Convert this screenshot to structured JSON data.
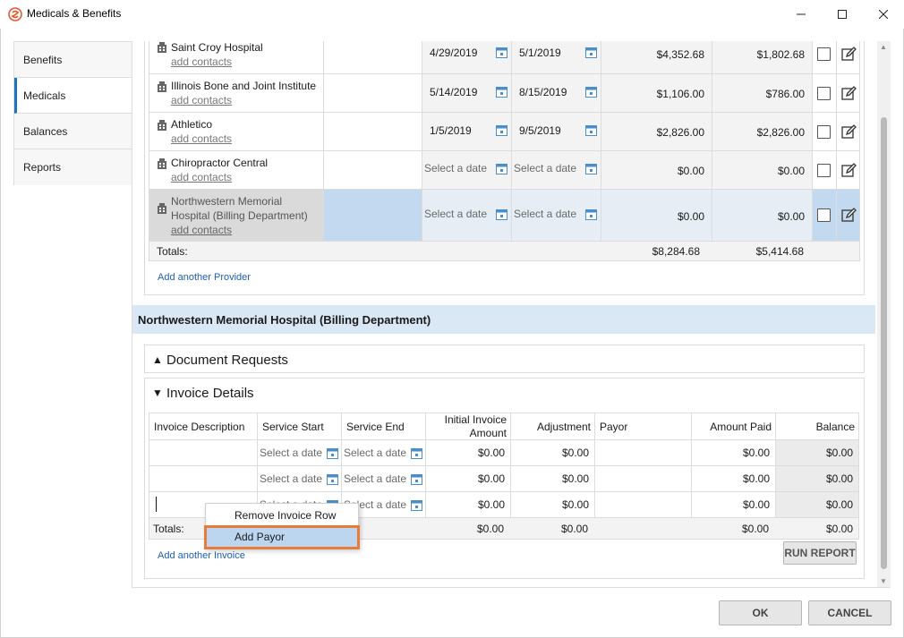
{
  "window": {
    "title": "Medicals & Benefits",
    "logo": "app-logo-icon",
    "controls": [
      "minimize-icon",
      "maximize-icon",
      "close-icon"
    ]
  },
  "nav": {
    "items": [
      {
        "label": "Benefits",
        "active": false
      },
      {
        "label": "Medicals",
        "active": true
      },
      {
        "label": "Balances",
        "active": false
      },
      {
        "label": "Reports",
        "active": false
      }
    ]
  },
  "providers": {
    "rows": [
      {
        "name": "Saint Croy Hospital",
        "contacts": "add contacts",
        "start": "4/29/2019",
        "end": "5/1/2019",
        "cost": "$4,352.68",
        "paid": "$1,802.68"
      },
      {
        "name": "Illinois Bone and Joint Institute",
        "contacts": "add contacts",
        "start": "5/14/2019",
        "end": "8/15/2019",
        "cost": "$1,106.00",
        "paid": "$786.00"
      },
      {
        "name": "Athletico",
        "contacts": "add contacts",
        "start": "1/5/2019",
        "end": "9/5/2019",
        "cost": "$2,826.00",
        "paid": "$2,826.00"
      },
      {
        "name": "Chiropractor Central",
        "contacts": "add contacts",
        "start": "Select a date",
        "end": "Select a date",
        "cost": "$0.00",
        "paid": "$0.00"
      },
      {
        "name_line1": "Northwestern Memorial",
        "name_line2": "Hospital (Billing Department)",
        "contacts": "add contacts",
        "start": "Select a date",
        "end": "Select a date",
        "cost": "$0.00",
        "paid": "$0.00",
        "selected": true
      }
    ],
    "totals_label": "Totals:",
    "total_cost": "$8,284.68",
    "total_paid": "$5,414.68",
    "add_link": "Add another Provider"
  },
  "selected_provider": {
    "title": "Northwestern Memorial Hospital (Billing Department)"
  },
  "document_requests": {
    "arrow": "▲",
    "title": "Document Requests"
  },
  "invoice_details": {
    "arrow": "▼",
    "title": "Invoice Details",
    "headers": {
      "desc": "Invoice Description",
      "start": "Service Start",
      "end": "Service End",
      "init_line1": "Initial Invoice",
      "init_line2": "Amount",
      "adj": "Adjustment",
      "payor": "Payor",
      "paid": "Amount Paid",
      "balance": "Balance"
    },
    "rows": [
      {
        "start": "Select a date",
        "end": "Select a date",
        "init": "$0.00",
        "adj": "$0.00",
        "paid": "$0.00",
        "balance": "$0.00"
      },
      {
        "start": "Select a date",
        "end": "Select a date",
        "init": "$0.00",
        "adj": "$0.00",
        "paid": "$0.00",
        "balance": "$0.00"
      },
      {
        "start": "Select a date",
        "end": "Select a date",
        "init": "$0.00",
        "adj": "$0.00",
        "paid": "$0.00",
        "balance": "$0.00"
      }
    ],
    "totals": {
      "label": "Totals:",
      "init": "$0.00",
      "adj": "$0.00",
      "paid": "$0.00",
      "balance": "$0.00"
    },
    "add_link": "Add another Invoice",
    "run_report": "RUN REPORT"
  },
  "context_menu": {
    "items": [
      "Remove Invoice Row",
      "Add Payor"
    ],
    "highlighted": "Add Payor"
  },
  "footer": {
    "ok": "OK",
    "cancel": "CANCEL"
  },
  "colors": {
    "accent": "#1e73be",
    "link": "#1e5fb4",
    "selected_row": "#c3d9ef",
    "section_band": "#dae8f5",
    "highlight_outline": "#e87a3a"
  }
}
